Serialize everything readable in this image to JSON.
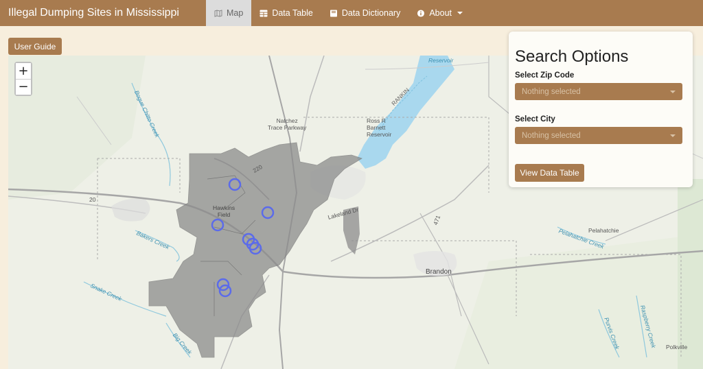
{
  "navbar": {
    "title": "Illegal Dumping Sites in Mississippi",
    "items": [
      {
        "label": "Map",
        "icon": "map-icon",
        "active": true
      },
      {
        "label": "Data Table",
        "icon": "table-icon"
      },
      {
        "label": "Data Dictionary",
        "icon": "book-icon"
      },
      {
        "label": "About",
        "icon": "info-icon"
      }
    ]
  },
  "user_guide_label": "User Guide",
  "map": {
    "zoom_in": "+",
    "zoom_out": "−",
    "place_labels": {
      "reservoir_top": "Reservoir",
      "natchez": "Natchez\nTrace Parkway",
      "ross": "Ross R\nBarnett\nReservoir",
      "rankin": "RANKIN",
      "bogue": "Bogue Chitto Creek",
      "hawkins": "Hawkins\nField",
      "lakeland": "Lakeland Dr",
      "bakers": "Bakers Creek",
      "brandon": "Brandon",
      "pelahatchie": "Pelahatchie",
      "pelahatchie_creek": "Pelahatchie Creek",
      "snake": "Snake Creek",
      "big_creek": "Big Creek",
      "purvis": "Purvis Creek",
      "raspberry": "Raspberry Creek",
      "polkville": "Polkville",
      "hwy_220": "220",
      "hwy_20": "20",
      "hwy_471": "471"
    },
    "colors": {
      "region_fill": "#8c8c8c",
      "marker_stroke": "#5b6bea",
      "water": "#a9d8ee"
    }
  },
  "search": {
    "title": "Search Options",
    "zip_label": "Select Zip Code",
    "zip_placeholder": "Nothing selected",
    "city_label": "Select City",
    "city_placeholder": "Nothing selected",
    "view_button": "View Data Table"
  }
}
